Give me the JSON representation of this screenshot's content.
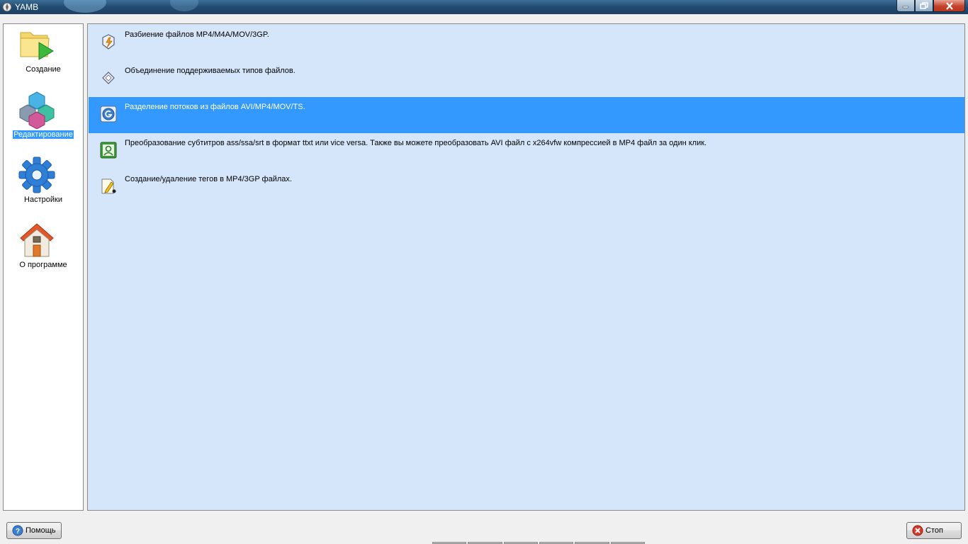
{
  "window": {
    "title": "YAMB"
  },
  "sidebar": {
    "items": [
      {
        "label": "Создание",
        "icon": "folder-play-icon",
        "active": false
      },
      {
        "label": "Редактирование",
        "icon": "cubes-icon",
        "active": true
      },
      {
        "label": "Настройки",
        "icon": "gear-icon",
        "active": false
      },
      {
        "label": "О программе",
        "icon": "home-icon",
        "active": false
      }
    ]
  },
  "main": {
    "items": [
      {
        "text": "Разбиение файлов MP4/M4A/MOV/3GP.",
        "icon": "split-icon"
      },
      {
        "text": "Объединение поддерживаемых типов файлов.",
        "icon": "join-icon"
      },
      {
        "text": "Разделение потоков из файлов AVI/MP4/MOV/TS.",
        "icon": "demux-icon",
        "selected": true
      },
      {
        "text": "Преобразование субтитров ass/ssa/srt в формат ttxt или vice versa. Также вы можете преобразовать AVI файл с x264vfw компрессией в MP4 файл за один клик.",
        "icon": "subtitle-convert-icon"
      },
      {
        "text": "Создание/удаление тегов в MP4/3GP файлах.",
        "icon": "tag-edit-icon"
      }
    ]
  },
  "footer": {
    "help_label": "Помощь",
    "stop_label": "Стоп"
  },
  "colors": {
    "selection": "#3399ff",
    "content_bg": "#d5e6fa"
  }
}
